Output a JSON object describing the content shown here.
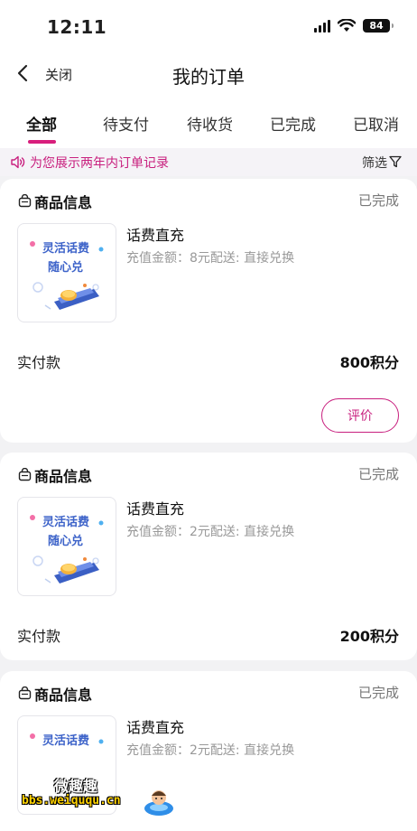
{
  "status_bar": {
    "time": "12:11",
    "battery": "84"
  },
  "nav": {
    "close_label": "关闭",
    "title": "我的订单"
  },
  "tabs": [
    {
      "label": "全部",
      "active": true
    },
    {
      "label": "待支付",
      "active": false
    },
    {
      "label": "待收货",
      "active": false
    },
    {
      "label": "已完成",
      "active": false
    },
    {
      "label": "已取消",
      "active": false
    }
  ],
  "notice": {
    "text": "为您展示两年内订单记录",
    "filter_label": "筛选"
  },
  "orders": [
    {
      "section_title": "商品信息",
      "status": "已完成",
      "thumb_line1": "灵活话费",
      "thumb_line2": "随心兑",
      "product_name": "话费直充",
      "detail": "充值金额：8元配送: 直接兑换",
      "paid_label": "实付款",
      "paid_value": "800积分",
      "review_label": "评价"
    },
    {
      "section_title": "商品信息",
      "status": "已完成",
      "thumb_line1": "灵活话费",
      "thumb_line2": "随心兑",
      "product_name": "话费直充",
      "detail": "充值金额：2元配送: 直接兑换",
      "paid_label": "实付款",
      "paid_value": "200积分"
    },
    {
      "section_title": "商品信息",
      "status": "已完成",
      "thumb_line1": "灵活话费",
      "product_name": "话费直充",
      "detail": "充值金额：2元配送: 直接兑换"
    }
  ],
  "watermark": {
    "title": "微趣趣",
    "url": "bbs.weiququ.cn"
  },
  "colors": {
    "accent": "#d81e7c",
    "thumb_text": "#3d63c9",
    "muted": "#999999"
  },
  "icons": [
    "back-chevron-icon",
    "speaker-icon",
    "filter-funnel-icon",
    "shopping-bag-icon",
    "wifi-icon",
    "signal-icon",
    "battery-icon"
  ]
}
